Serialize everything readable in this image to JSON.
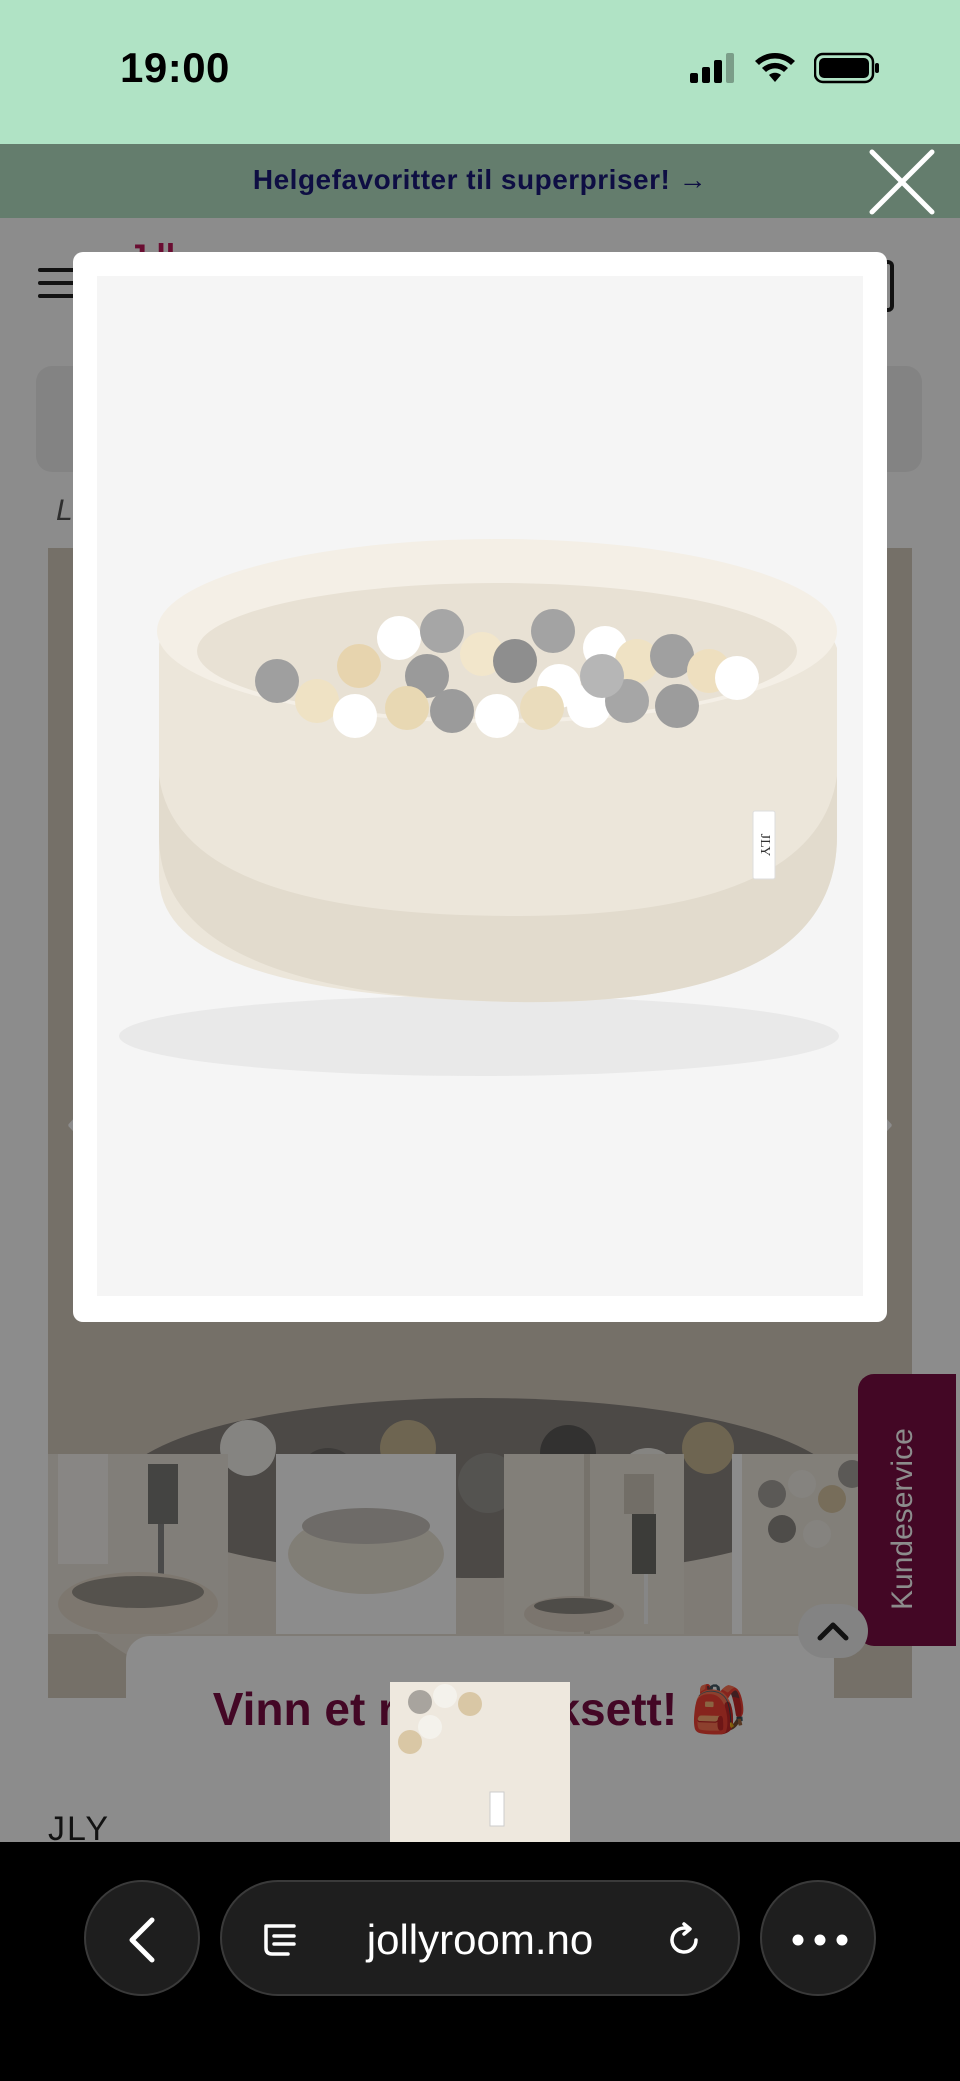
{
  "status_bar": {
    "time": "19:00",
    "icons": [
      "cellular-signal-icon",
      "wifi-icon",
      "battery-icon"
    ]
  },
  "promo_banner": {
    "text": "Helgefavoritter til superpriser! →"
  },
  "page": {
    "logo_fragment": "J.ll",
    "breadcrumb_fragment": "L",
    "brand_fragment": "JLY",
    "product_image_alt": "Ballbinge med baller",
    "thumbnails": [
      {
        "name": "ball pit with coat rack"
      },
      {
        "name": "ball pit on white"
      },
      {
        "name": "ball pit in room corner"
      },
      {
        "name": "ball pit close-up"
      }
    ],
    "customer_service_label": "Kundeservice",
    "promo_popup_text": "Vinn et ryggsekksett! 🎒",
    "brand_on_product": "JLY"
  },
  "browser": {
    "url": "jollyroom.no",
    "icons": [
      "back-arrow-icon",
      "tabs-icon",
      "reload-icon",
      "more-icon"
    ]
  },
  "colors": {
    "status_bar_bg": "#b0e3c5",
    "banner_text": "#1a1a7a",
    "accent": "#7a0e44"
  }
}
